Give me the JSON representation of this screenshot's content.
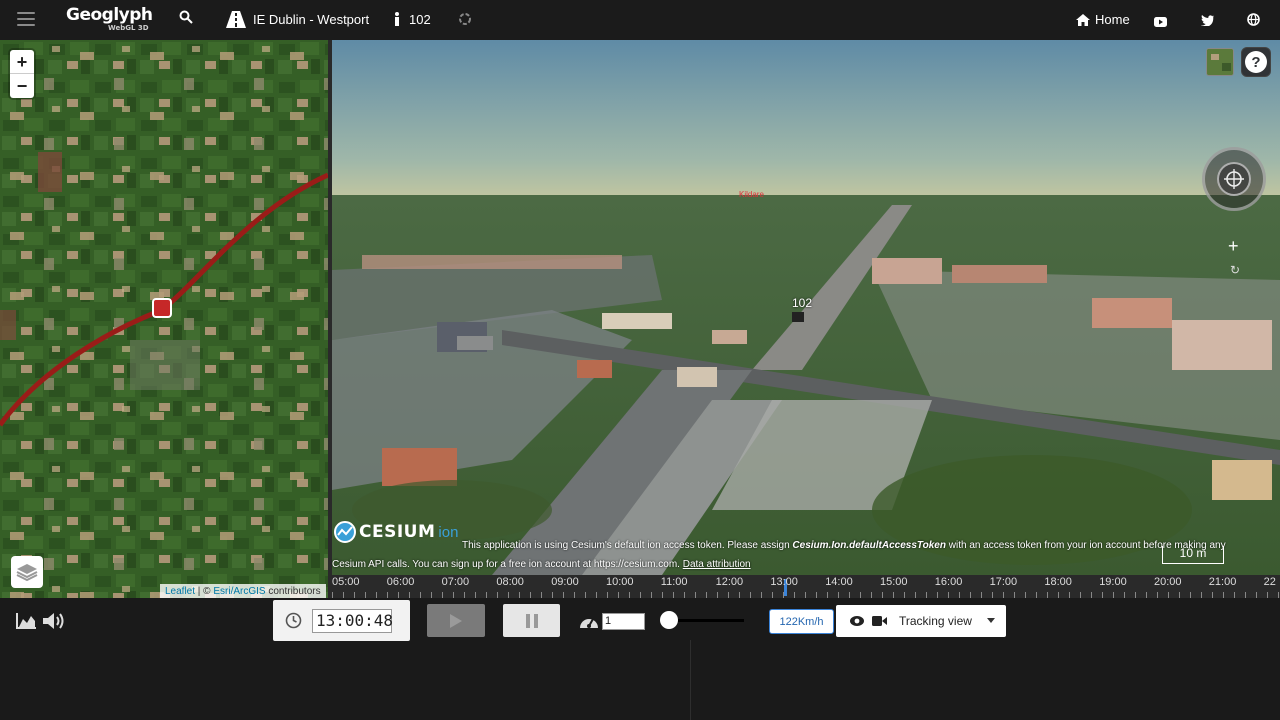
{
  "topbar": {
    "menu_icon": "hamburger-menu-icon",
    "logo": "Geoglyph",
    "logo_sub": "WebGL 3D",
    "search_icon": "search-icon",
    "route_icon": "road-icon",
    "route_name": "IE Dublin - Westport",
    "info_icon": "info-icon",
    "vehicle_count": "102",
    "sync_icon": "sync-icon",
    "home_icon": "home-icon",
    "home_label": "Home",
    "social_icons": [
      "youtube-icon",
      "twitter-icon",
      "globe-icon"
    ]
  },
  "left_map": {
    "zoom_in": "+",
    "zoom_out": "−",
    "layers_icon": "layers-icon",
    "attribution": {
      "leaflet": "Leaflet",
      "separator": " | © ",
      "esri": "Esri/ArcGIS",
      "contributors": " contributors"
    },
    "route_color": "#b0211d",
    "marker_icon": "train-marker-icon"
  },
  "scene": {
    "help_label": "?",
    "vehicle_label": "102",
    "city_label": "Kildare",
    "cesium_logo": "CESIUM",
    "cesium_ion": "ion",
    "ion_notice": {
      "part1": "This application is using Cesium's default ion access token. Please assign ",
      "code": "Cesium.Ion.defaultAccessToken",
      "part2": " with an access token from your ion account before making any Cesium API calls. You can sign up for a free ion account at https://cesium.com. ",
      "link": "Data attribution"
    },
    "scale": "10 m"
  },
  "timeline": {
    "labels": [
      "05:00",
      "06:00",
      "07:00",
      "08:00",
      "09:00",
      "10:00",
      "11:00",
      "12:00",
      "13:00",
      "14:00",
      "15:00",
      "16:00",
      "17:00",
      "18:00",
      "19:00",
      "20:00",
      "21:00",
      "22"
    ],
    "accent": "#3b84d9"
  },
  "controls": {
    "chart_icon": "area-chart-icon",
    "sound_icon": "volume-icon",
    "clock_icon": "clock-icon",
    "time": "13:00:48",
    "play_icon": "play-icon",
    "pause_icon": "pause-icon",
    "speedometer_icon": "speedometer-icon",
    "multiplier": "1",
    "speed": "122Km/h",
    "view_label": "Tracking view",
    "eye_icon": "eye-icon",
    "camera_icon": "video-camera-icon"
  }
}
